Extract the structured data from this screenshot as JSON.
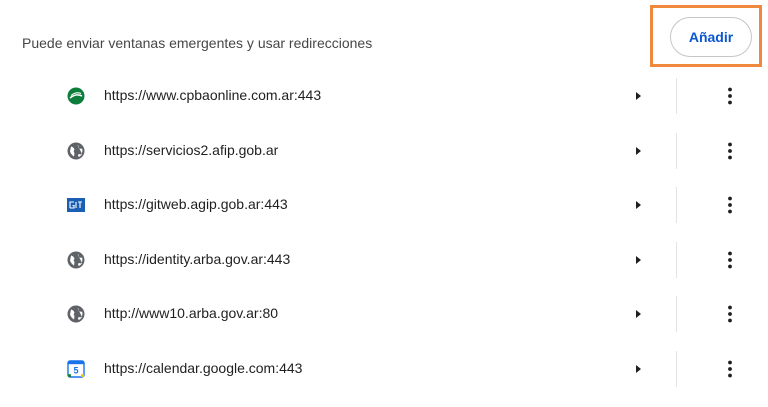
{
  "header": {
    "label": "Puede enviar ventanas emergentes y usar redirecciones",
    "add_label": "Añadir"
  },
  "colors": {
    "accent": "#0b57d0",
    "highlight": "#f0883e",
    "divider": "#e3e3e3"
  },
  "sites": [
    {
      "url": "https://www.cpbaonline.com.ar:443",
      "icon": "cpba-logo-icon"
    },
    {
      "url": "https://servicios2.afip.gob.ar",
      "icon": "globe-icon"
    },
    {
      "url": "https://gitweb.agip.gob.ar:443",
      "icon": "git-logo-icon"
    },
    {
      "url": "https://identity.arba.gov.ar:443",
      "icon": "globe-icon"
    },
    {
      "url": "http://www10.arba.gov.ar:80",
      "icon": "globe-icon"
    },
    {
      "url": "https://calendar.google.com:443",
      "icon": "google-calendar-icon"
    }
  ],
  "calendar_icon_day": "5"
}
